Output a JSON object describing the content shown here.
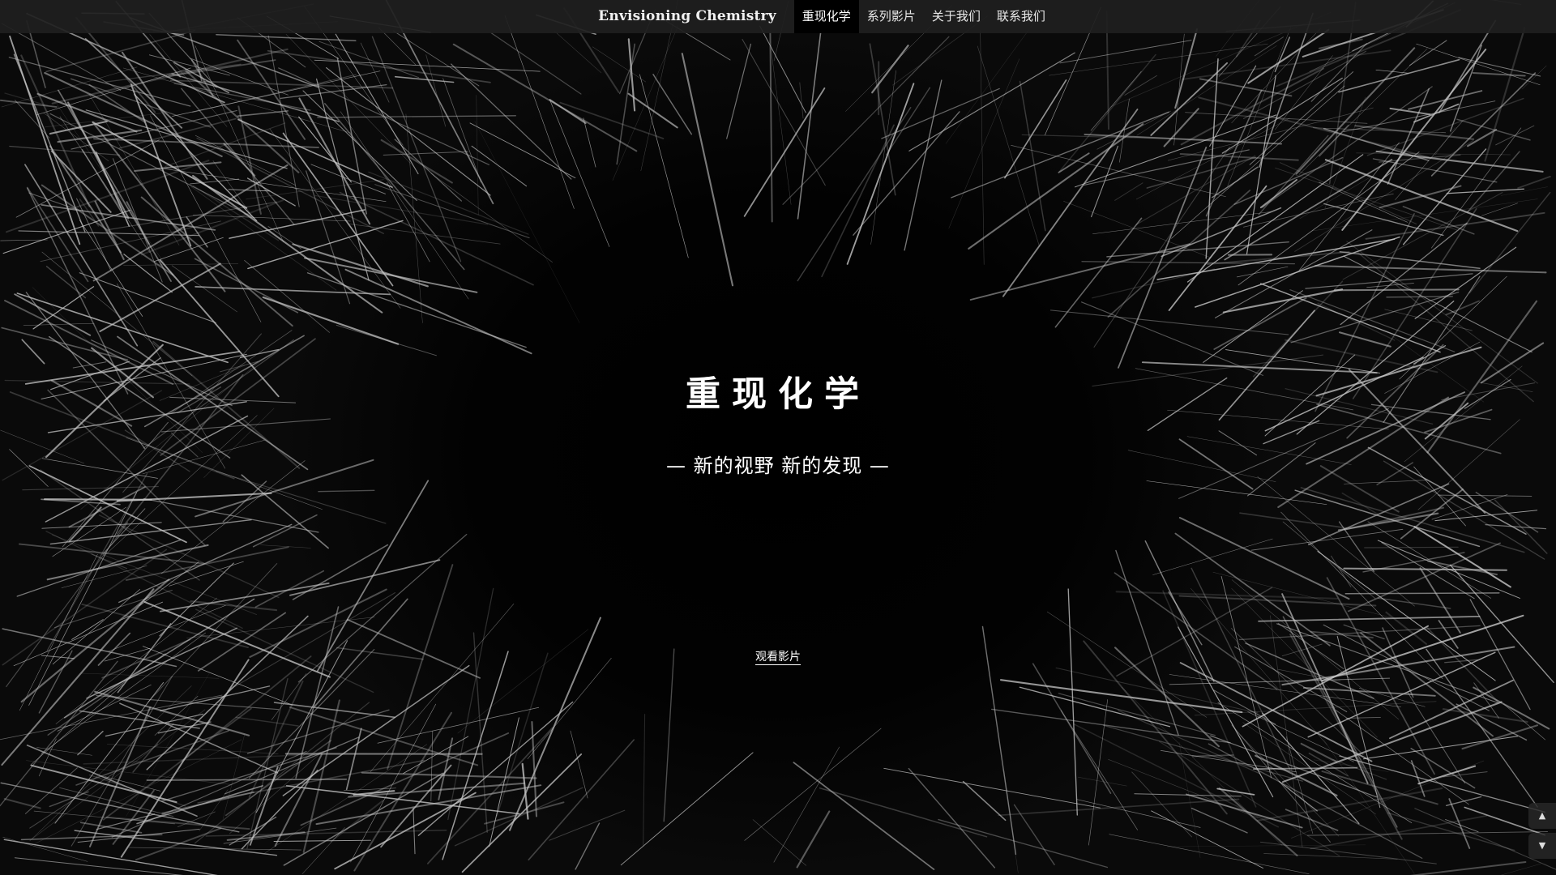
{
  "brand": "Envisioning Chemistry",
  "nav": {
    "items": [
      {
        "label": "重现化学",
        "active": true
      },
      {
        "label": "系列影片",
        "active": false
      },
      {
        "label": "关于我们",
        "active": false
      },
      {
        "label": "联系我们",
        "active": false
      }
    ]
  },
  "hero": {
    "title": "重现化学",
    "subtitle": "— 新的视野 新的发现 —",
    "link_label": "观看影片"
  },
  "scroll_controls": {
    "up_icon": "triangle-up-icon",
    "down_icon": "triangle-down-icon"
  },
  "colors": {
    "background": "#000000",
    "navbar": "#202020",
    "text": "#ffffff",
    "crystal": "#b8b8b8"
  }
}
